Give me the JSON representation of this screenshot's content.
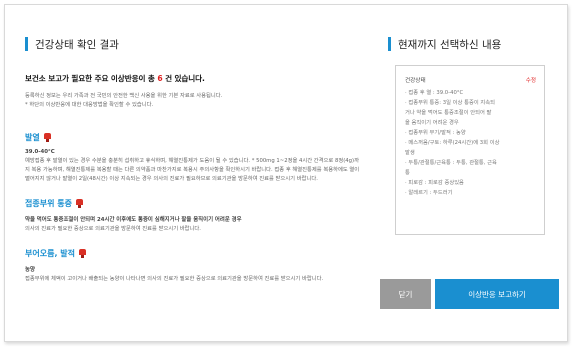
{
  "left": {
    "title": "건강상태 확인 결과",
    "headline_prefix": "보건소 보고가 필요한 주요 이상반응이 총",
    "headline_count": "6",
    "headline_suffix": "건 있습니다.",
    "note1": "등록하신 정보는 우리 가족과 전 국민의 안전한 백신 사용을 위한 기본 자료로 사용됩니다.",
    "note2": "* 하단의 이상반응에 대한 대응방법을 확인할 수 있습니다.",
    "items": [
      {
        "title": "발열",
        "icon": "thermometer-icon",
        "sub": "39.0-40°C",
        "text": "예방접종 후 발열이 있는 경우 수분을 충분히 섭취하고 휴식하며, 해열진통제가 도움이 될 수 있습니다. * 500mg 1~2정을 4시간 간격으로 8정(4g)까지 복용 가능하며, 해열진통제를 복용할 때는 다른 의약품과 마찬가지로 복용시 주의사항을 확인하시기 바랍니다. 접종 후 해열진통제를 복용하에도 열이 떨어지지 않거나 발열이 2일(48시간) 이상 지속되는 경우 의사의 진료가 필요하므로 의료기관을 방문하여 진료를 받으시기 바랍니다."
      },
      {
        "title": "접종부위 통증",
        "icon": "thermometer-icon",
        "sub": "약을 먹어도 통증조절이 안되며 24시간 이후에도 통증이 심해지거나 팔을 움직이기 어려운 경우",
        "text": "의사의 진료가 필요한 증상으로 의료기관을 방문하여 진료를 받으시기 바랍니다."
      },
      {
        "title": "부어오름, 발적",
        "icon": "thermometer-icon",
        "sub": "농양",
        "text": "접종부위에 체액이 고이거나 배출되는 농양이 나타나면 의사의 진료가 필요한 증상으로 의료기관을 방문하여 진료를 받으시기 바랍니다."
      }
    ]
  },
  "right": {
    "title": "현재까지 선택하신 내용",
    "panel_label": "건강상태",
    "edit_label": "수정",
    "selections": [
      "· 접종 후 열 : 39.0-40°C",
      "· 접종부위 통증: 3일 이상 통증이 지속되",
      "  거나 약을 먹어도 통증조절이 안되어 팔",
      "  을 움직이기 어려운 경우",
      "· 접종부위 부기/발적 : 농양",
      "· 메스꺼움/구토: 하루(24시간)에 3회 이상",
      "  발생",
      "· 두통/관절통/근육통 : 두통, 관절통, 근육",
      "  통",
      "· 피로감 : 피로감 증상있음",
      "· 알레르기 : 두드러기"
    ]
  },
  "buttons": {
    "close": "닫기",
    "report": "이상반응 보고하기"
  }
}
